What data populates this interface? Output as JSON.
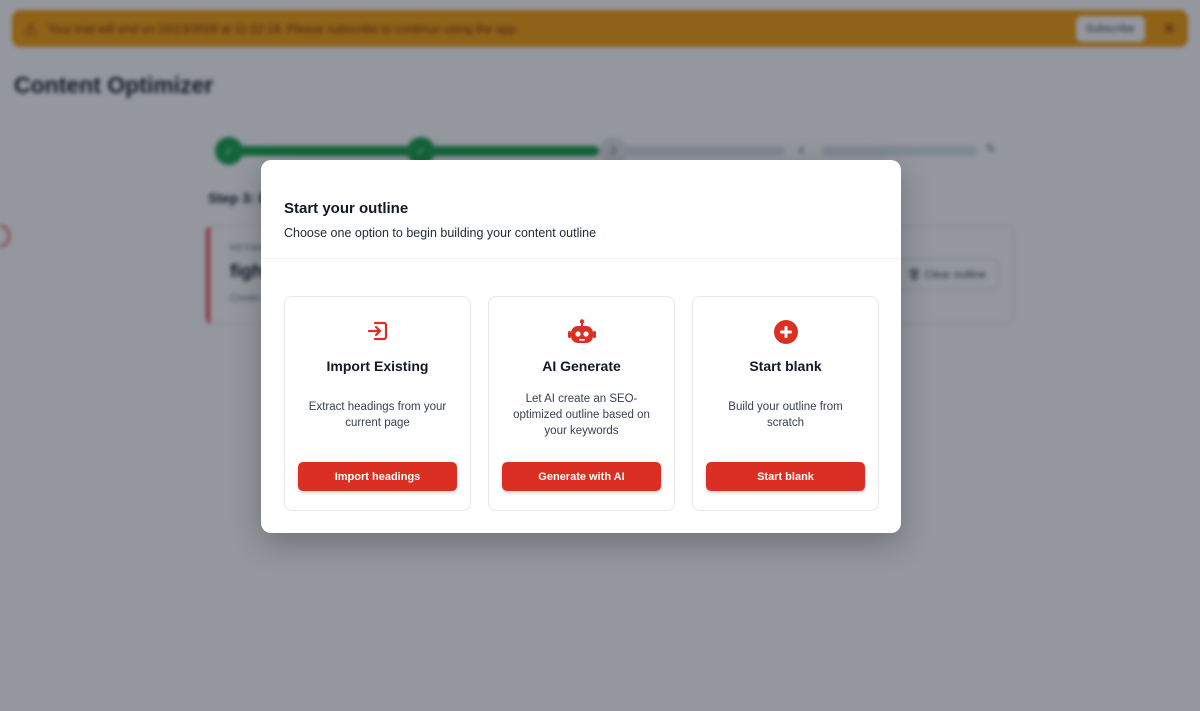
{
  "banner": {
    "icon": "warning-icon",
    "message": "Your trial will end on 10/23/2026 at 11:22:18. Please subscribe to continue using the app.",
    "subscribe_label": "Subscribe",
    "close_icon": "close-icon"
  },
  "page": {
    "title": "Content Optimizer",
    "step_heading": "Step 3: B",
    "stepper": {
      "steps": [
        "✓",
        "✓",
        "3",
        "4"
      ],
      "end_icon": "pencil-icon"
    },
    "outline_card": {
      "label": "KEYWORD",
      "value": "fight",
      "sub": "Create",
      "clear_label": "Clear outline"
    }
  },
  "modal": {
    "title": "Start your outline",
    "subtitle": "Choose one option to begin building your content outline",
    "options": [
      {
        "icon": "import-icon",
        "title": "Import Existing",
        "description": "Extract headings from your current page",
        "button": "Import headings"
      },
      {
        "icon": "robot-icon",
        "title": "AI Generate",
        "description": "Let AI create an SEO-optimized outline based on your keywords",
        "button": "Generate with AI"
      },
      {
        "icon": "plus-circle-icon",
        "title": "Start blank",
        "description": "Build your outline from scratch",
        "button": "Start blank"
      }
    ]
  },
  "colors": {
    "accent": "#dc2f24",
    "banner": "#f59e0b",
    "progress": "#16a34a"
  }
}
